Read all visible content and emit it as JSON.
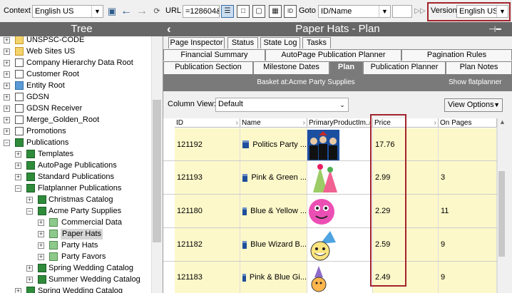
{
  "toolbar": {
    "context_label": "Context",
    "context_value": "English US",
    "url_label": "URL",
    "url_value": "=128604&",
    "goto_label": "Goto",
    "goto_value": "ID/Name",
    "goto_input": "",
    "version_label": "Version",
    "version_value": "English US"
  },
  "tree": {
    "title": "Tree",
    "items": [
      {
        "label": "UNSPSC-CODE"
      },
      {
        "label": "Web Sites US"
      },
      {
        "label": "Company Hierarchy Data Root"
      },
      {
        "label": "Customer Root"
      },
      {
        "label": "Entity Root"
      },
      {
        "label": "GDSN"
      },
      {
        "label": "GDSN Receiver"
      },
      {
        "label": "Merge_Golden_Root"
      },
      {
        "label": "Promotions"
      },
      {
        "label": "Publications"
      },
      {
        "label": "Templates"
      },
      {
        "label": "AutoPage Publications"
      },
      {
        "label": "Standard Publications"
      },
      {
        "label": "Flatplanner Publications"
      },
      {
        "label": "Christmas Catalog"
      },
      {
        "label": "Acme Party Supplies"
      },
      {
        "label": "Commercial Data"
      },
      {
        "label": "Paper Hats"
      },
      {
        "label": "Party Hats"
      },
      {
        "label": "Party Favors"
      },
      {
        "label": "Spring Wedding Catalog"
      },
      {
        "label": "Summer Wedding Catalog"
      },
      {
        "label": "Spring Wedding Catalog"
      }
    ]
  },
  "panel": {
    "title": "Paper Hats - Plan",
    "tabs_row1": [
      "Page Inspector",
      "Status",
      "State Log",
      "Tasks"
    ],
    "tabs_row2": [
      "Financial Summary",
      "AutoPage Publication Planner",
      "Pagination Rules"
    ],
    "tabs_row3": [
      "Publication Section",
      "Milestone Dates",
      "Plan",
      "Publication Planner",
      "Plan Notes"
    ],
    "basket_label": "Basket at:Acme Party Supplies",
    "show_flatplanner": "Show flatplanner",
    "column_view_label": "Column View:",
    "column_view_value": "Default",
    "view_options_label": "View Options"
  },
  "grid": {
    "columns": [
      "ID",
      "Name",
      "PrimaryProductIm...",
      "Price",
      "On Pages"
    ],
    "rows": [
      {
        "id": "121192",
        "name": "Politics Party ...",
        "price": "17.76",
        "pages": ""
      },
      {
        "id": "121193",
        "name": "Pink & Green ...",
        "price": "2.99",
        "pages": "3"
      },
      {
        "id": "121180",
        "name": "Blue & Yellow ...",
        "price": "2.29",
        "pages": "11"
      },
      {
        "id": "121182",
        "name": "Blue Wizard B...",
        "price": "2.59",
        "pages": "9"
      },
      {
        "id": "121183",
        "name": "Pink & Blue Gi...",
        "price": "2.49",
        "pages": "9"
      }
    ]
  },
  "colors": {
    "header_gray": "#676767",
    "highlight_red": "#a3242c",
    "row_yellow": "#fdf8c9"
  }
}
